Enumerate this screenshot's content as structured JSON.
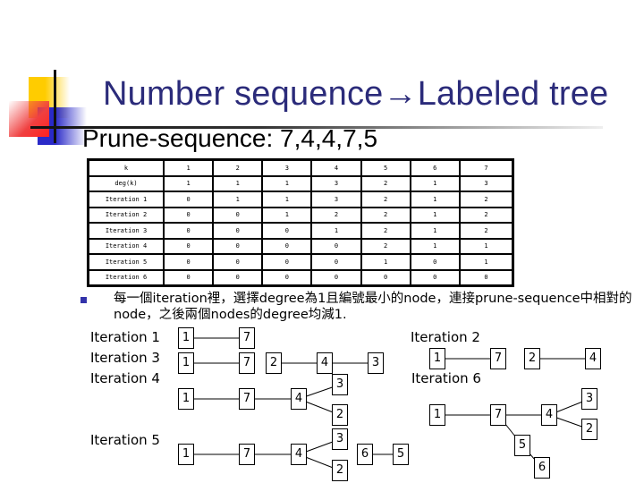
{
  "slide": {
    "title": "Number sequence→Labeled tree",
    "subtitle": "Prune-sequence: 7,4,4,7,5"
  },
  "table": {
    "header": [
      "k",
      "1",
      "2",
      "3",
      "4",
      "5",
      "6",
      "7"
    ],
    "rows": [
      [
        "deg(k)",
        "1",
        "1",
        "1",
        "3",
        "2",
        "1",
        "3"
      ],
      [
        "Iteration 1",
        "0",
        "1",
        "1",
        "3",
        "2",
        "1",
        "2"
      ],
      [
        "Iteration 2",
        "0",
        "0",
        "1",
        "2",
        "2",
        "1",
        "2"
      ],
      [
        "Iteration 3",
        "0",
        "0",
        "0",
        "1",
        "2",
        "1",
        "2"
      ],
      [
        "Iteration 4",
        "0",
        "0",
        "0",
        "0",
        "2",
        "1",
        "1"
      ],
      [
        "Iteration 5",
        "0",
        "0",
        "0",
        "0",
        "1",
        "0",
        "1"
      ],
      [
        "Iteration 6",
        "0",
        "0",
        "0",
        "0",
        "0",
        "0",
        "0"
      ]
    ]
  },
  "note": {
    "bullet_icon": "square-bullet-icon",
    "text": "每一個iteration裡，選擇degree為1且編號最小的node，連接prune-sequence中相對的node，之後兩個nodes的degree均減1."
  },
  "iterations": {
    "labels": {
      "it1": "Iteration 1",
      "it2": "Iteration 2",
      "it3": "Iteration 3",
      "it4": "Iteration 4",
      "it5": "Iteration 5",
      "it6": "Iteration 6"
    },
    "trees": {
      "it1": {
        "nodes": [
          "1",
          "7"
        ],
        "edges": [
          [
            "1",
            "7"
          ]
        ]
      },
      "it2": {
        "nodes": [
          "1",
          "7",
          "2",
          "4"
        ],
        "edges": [
          [
            "1",
            "7"
          ],
          [
            "2",
            "4"
          ]
        ]
      },
      "it3": {
        "nodes": [
          "1",
          "7",
          "2",
          "4",
          "3"
        ],
        "edges": [
          [
            "1",
            "7"
          ],
          [
            "2",
            "4"
          ],
          [
            "4",
            "3"
          ]
        ]
      },
      "it4": {
        "nodes": [
          "1",
          "7",
          "4",
          "3",
          "2"
        ],
        "edges": [
          [
            "1",
            "7"
          ],
          [
            "7",
            "4"
          ],
          [
            "4",
            "3"
          ],
          [
            "4",
            "2"
          ]
        ]
      },
      "it5": {
        "nodes": [
          "1",
          "7",
          "4",
          "3",
          "2",
          "6",
          "5"
        ],
        "edges": [
          [
            "1",
            "7"
          ],
          [
            "7",
            "4"
          ],
          [
            "4",
            "3"
          ],
          [
            "4",
            "2"
          ],
          [
            "6",
            "5"
          ]
        ]
      },
      "it6": {
        "nodes": [
          "1",
          "7",
          "4",
          "3",
          "2",
          "5",
          "6"
        ],
        "edges": [
          [
            "1",
            "7"
          ],
          [
            "7",
            "4"
          ],
          [
            "4",
            "3"
          ],
          [
            "4",
            "2"
          ],
          [
            "7",
            "5"
          ],
          [
            "5",
            "6"
          ]
        ]
      }
    }
  }
}
